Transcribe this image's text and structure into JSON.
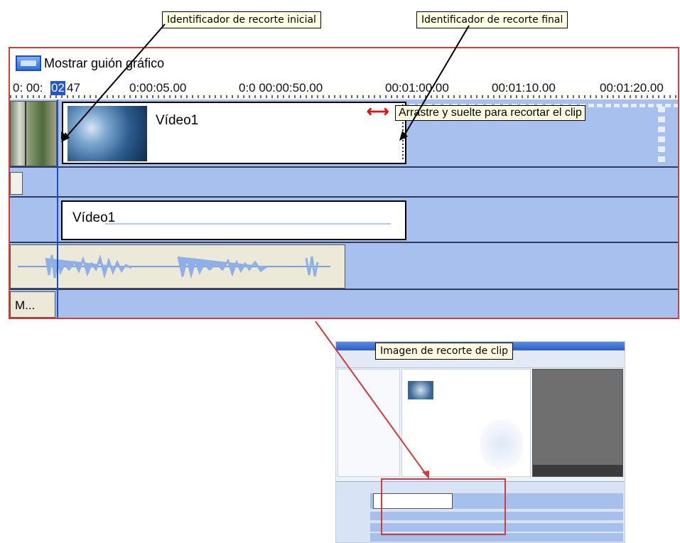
{
  "callouts": {
    "start_trim": "Identificador de recorte inicial",
    "end_trim": "Identificador de recorte final",
    "clip_image": "Imagen de recorte de clip"
  },
  "storyboard": {
    "label": "Mostrar guión gráfico"
  },
  "ruler": {
    "ticks": [
      "0: 00:",
      "02",
      "47",
      "0:00:05.00",
      "0:0 00:00:50.00",
      "00:01:00.00",
      "00:01:10.00",
      "00:01:20.00"
    ]
  },
  "video_track": {
    "clip_title": "Vídeo1",
    "tooltip": "Arrastre y suelte para recortar el clip"
  },
  "effect_track": {
    "clip_title": "Vídeo1"
  },
  "music_track": {
    "clip_label": "M..."
  },
  "colors": {
    "frame": "#d23c3c",
    "track": "#a8c0ee",
    "playhead": "#1f4fbf",
    "tooltip": "#ffffe1"
  }
}
